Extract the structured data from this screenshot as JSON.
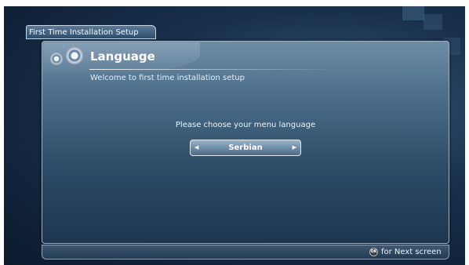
{
  "header": {
    "tab_title": "First Time Installation Setup"
  },
  "panel": {
    "title": "Language",
    "subtitle": "Welcome to first time installation setup",
    "prompt": "Please choose your menu language",
    "language_select": {
      "value": "Serbian"
    }
  },
  "footer": {
    "ok_label": "OK",
    "hint": "for Next screen"
  },
  "icons": {
    "gears": "gear-icon",
    "left": "arrow-left-icon",
    "right": "arrow-right-icon",
    "ok": "ok-button-icon"
  },
  "colors": {
    "background": "#18304c",
    "panel": "#4b6d89",
    "selector": "#6d8ba6",
    "text": "#ffffff"
  }
}
